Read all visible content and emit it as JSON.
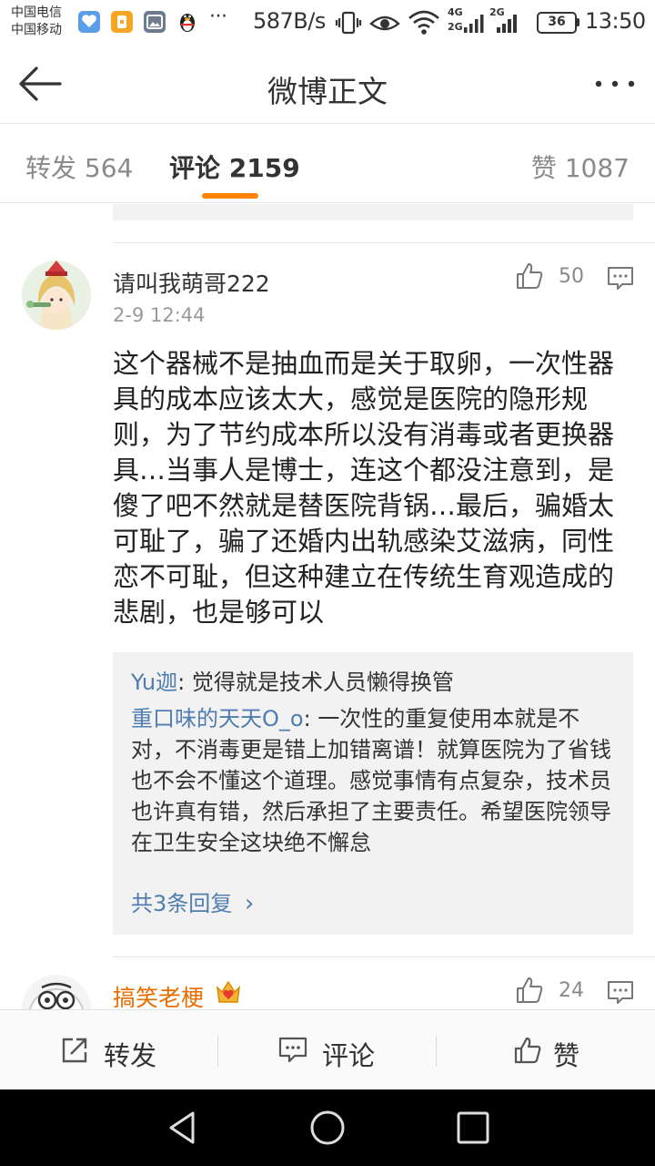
{
  "status_bar": {
    "carrier1": "中国电信",
    "carrier2": "中国移动",
    "overflow": "···",
    "net_speed": "587B/s",
    "net1": "4G",
    "net2": "2G",
    "net3": "2G",
    "battery": "36",
    "time": "13:50"
  },
  "header": {
    "title": "微博正文",
    "back_icon": "back-arrow-icon",
    "more_icon": "more-dots-icon"
  },
  "tabs": [
    {
      "label": "转发 564",
      "active": false
    },
    {
      "label": "评论 2159",
      "active": true
    },
    {
      "label": "赞 1087",
      "active": false
    }
  ],
  "accent_color": "#ff8200",
  "link_color": "#507daf",
  "comment": {
    "username": "请叫我萌哥222",
    "time": "2-9 12:44",
    "likes": "50",
    "text": "这个器械不是抽血而是关于取卵，一次性器具的成本应该太大，感觉是医院的隐形规则，为了节约成本所以没有消毒或者更换器具…当事人是博士，连这个都没注意到，是傻了吧不然就是替医院背锅…最后，骗婚太可耻了，骗了还婚内出轨感染艾滋病，同性恋不可耻，但这种建立在传统生育观造成的悲剧，也是够可以",
    "replies": [
      {
        "user": "Yu迦",
        "sep": ": ",
        "text": "觉得就是技术人员懒得换管"
      },
      {
        "user": "重口味的天天O_o",
        "sep": ": ",
        "text": "一次性的重复使用本就是不对，不消毒更是错上加错离谱！就算医院为了省钱也不会不懂这个道理。感觉事情有点复杂，技术员也许真有错，然后承担了主要责任。希望医院领导在卫生安全这块绝不懈怠"
      }
    ],
    "replies_total": "共3条回复",
    "chevron": "›"
  },
  "comment2": {
    "username": "搞笑老梗",
    "likes": "24",
    "badge_icon": "crown-heart-badge-icon"
  },
  "action_bar": {
    "repost": "转发",
    "comment": "评论",
    "like": "赞"
  }
}
